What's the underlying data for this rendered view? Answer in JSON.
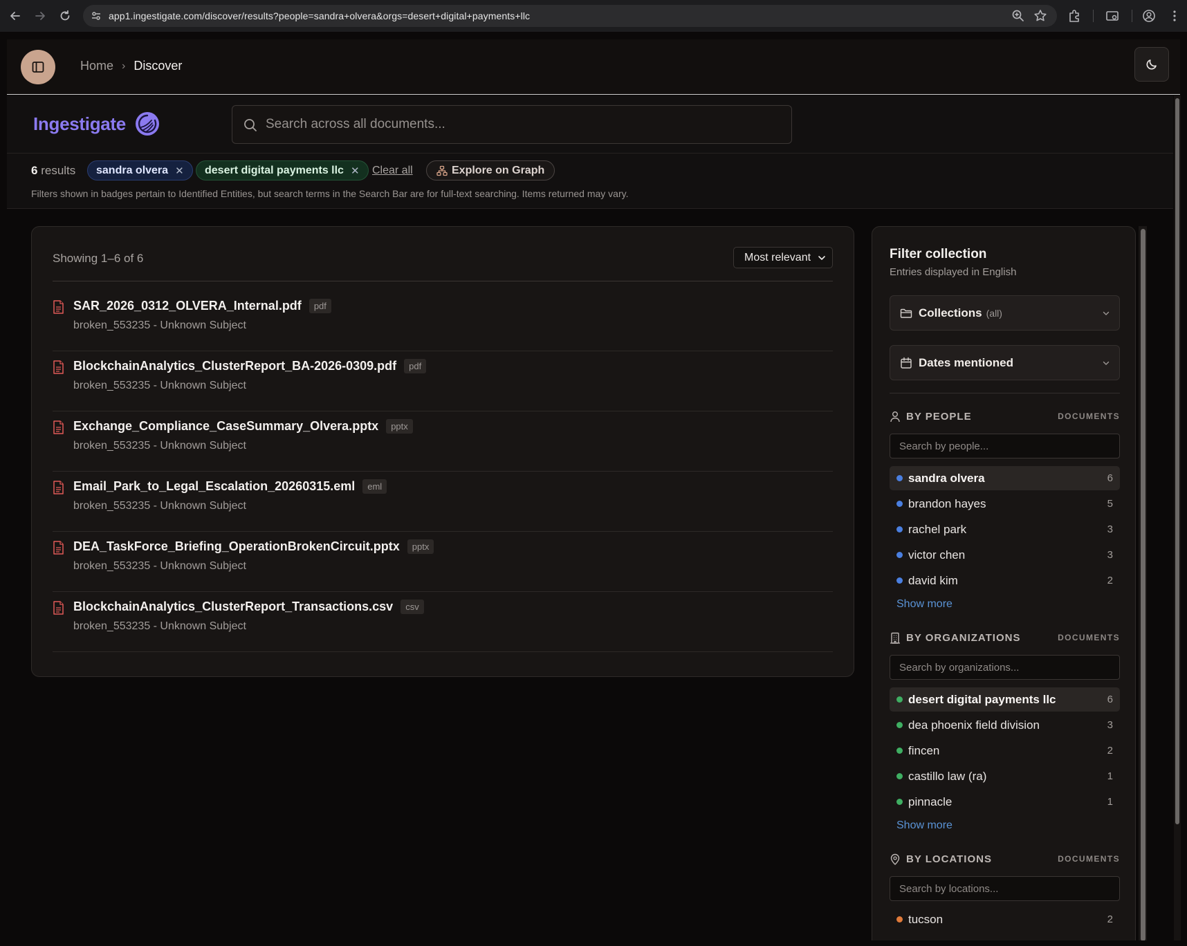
{
  "browser": {
    "url": "app1.ingestigate.com/discover/results?people=sandra+olvera&orgs=desert+digital+payments+llc"
  },
  "header": {
    "breadcrumb_home": "Home",
    "breadcrumb_sep": "›",
    "breadcrumb_current": "Discover"
  },
  "brand": {
    "name": "Ingestigate"
  },
  "search": {
    "placeholder": "Search across all documents..."
  },
  "filters": {
    "results_count": "6",
    "results_label": "results",
    "badges": [
      {
        "label": "sandra olvera",
        "type": "person"
      },
      {
        "label": "desert digital payments llc",
        "type": "organization"
      }
    ],
    "clear_all": "Clear all",
    "graph_button": "Explore on Graph",
    "note": "Filters shown in badges pertain to Identified Entities, but search terms in the Search Bar are for full-text searching. Items returned may vary."
  },
  "results": {
    "showing": "Showing 1–6 of 6",
    "sort_selected": "Most relevant",
    "items": [
      {
        "title": "SAR_2026_0312_OLVERA_Internal.pdf",
        "ext": "pdf",
        "subtitle": "broken_553235 - Unknown Subject"
      },
      {
        "title": "BlockchainAnalytics_ClusterReport_BA-2026-0309.pdf",
        "ext": "pdf",
        "subtitle": "broken_553235 - Unknown Subject"
      },
      {
        "title": "Exchange_Compliance_CaseSummary_Olvera.pptx",
        "ext": "pptx",
        "subtitle": "broken_553235 - Unknown Subject"
      },
      {
        "title": "Email_Park_to_Legal_Escalation_20260315.eml",
        "ext": "eml",
        "subtitle": "broken_553235 - Unknown Subject"
      },
      {
        "title": "DEA_TaskForce_Briefing_OperationBrokenCircuit.pptx",
        "ext": "pptx",
        "subtitle": "broken_553235 - Unknown Subject"
      },
      {
        "title": "BlockchainAnalytics_ClusterReport_Transactions.csv",
        "ext": "csv",
        "subtitle": "broken_553235 - Unknown Subject"
      }
    ]
  },
  "filter_panel": {
    "title": "Filter collection",
    "subtitle": "Entries displayed in English",
    "collections_label": "Collections",
    "collections_value": "(all)",
    "dates_label": "Dates mentioned",
    "documents_header": "DOCUMENTS",
    "show_more": "Show more",
    "people": {
      "title": "BY PEOPLE",
      "placeholder": "Search by people...",
      "color": "#4a7fe0",
      "items": [
        {
          "name": "sandra olvera",
          "count": "6",
          "selected": true
        },
        {
          "name": "brandon hayes",
          "count": "5"
        },
        {
          "name": "rachel park",
          "count": "3"
        },
        {
          "name": "victor chen",
          "count": "3"
        },
        {
          "name": "david kim",
          "count": "2"
        }
      ]
    },
    "organizations": {
      "title": "BY ORGANIZATIONS",
      "placeholder": "Search by organizations...",
      "color": "#3fae62",
      "items": [
        {
          "name": "desert digital payments llc",
          "count": "6",
          "selected": true
        },
        {
          "name": "dea phoenix field division",
          "count": "3"
        },
        {
          "name": "fincen",
          "count": "2"
        },
        {
          "name": "castillo law (ra)",
          "count": "1"
        },
        {
          "name": "pinnacle",
          "count": "1"
        }
      ]
    },
    "locations": {
      "title": "BY LOCATIONS",
      "placeholder": "Search by locations...",
      "color": "#e07a3a",
      "items": [
        {
          "name": "tucson",
          "count": "2"
        }
      ]
    }
  },
  "colors": {
    "accent_logo": "#8b7af0",
    "file_icon": "#e05a57",
    "link": "#5a93d6"
  }
}
